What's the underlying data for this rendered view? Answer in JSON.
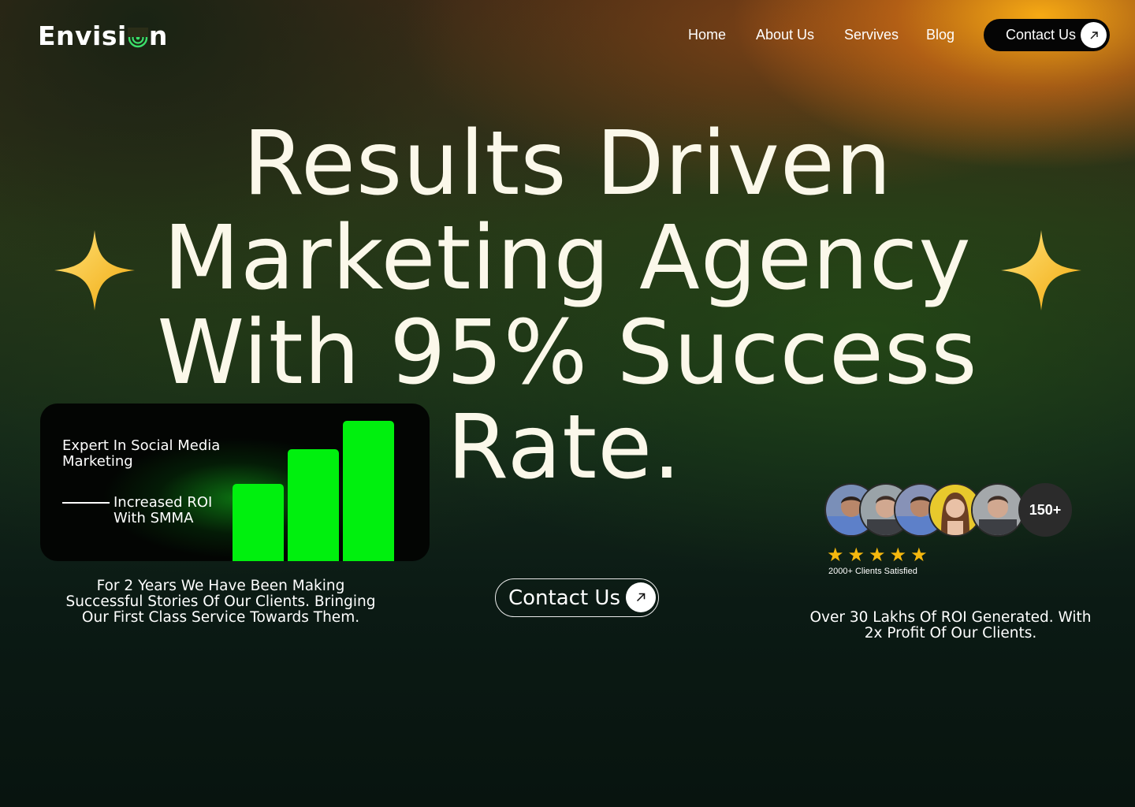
{
  "brand": {
    "logo_before": "Envisi",
    "logo_after": "n",
    "logo_icon": "target-o-icon"
  },
  "nav": {
    "items": [
      {
        "label": "Home"
      },
      {
        "label": "About Us"
      },
      {
        "label": "Servives"
      },
      {
        "label": "Blog"
      }
    ],
    "contact_label": "Contact Us",
    "contact_icon": "arrow-up-right-icon"
  },
  "hero": {
    "lines": [
      "Results Driven",
      "Marketing Agency",
      "With 95% Success",
      "Rate."
    ],
    "sparkle_icon": "sparkle-icon",
    "sparkle_color": "#f7c325"
  },
  "card": {
    "title": "Expert In Social Media Marketing",
    "subtitle": "Increased ROI With SMMA",
    "bar_color": "#00f00e",
    "bar_levels": [
      0.55,
      0.8,
      1.0
    ]
  },
  "left_text": "For 2 Years We Have Been Making Successful Stories Of Our Clients. Bringing Our First Class Service Towards Them.",
  "cta": {
    "label": "Contact Us",
    "icon": "arrow-up-right-icon"
  },
  "social_proof": {
    "count": "150+",
    "stars": 5,
    "star_color": "#f5b80e",
    "clients_text": "2000+ Clients Satisfied"
  },
  "right_text": "Over 30 Lakhs Of ROI Generated. With 2x Profit Of Our Clients."
}
